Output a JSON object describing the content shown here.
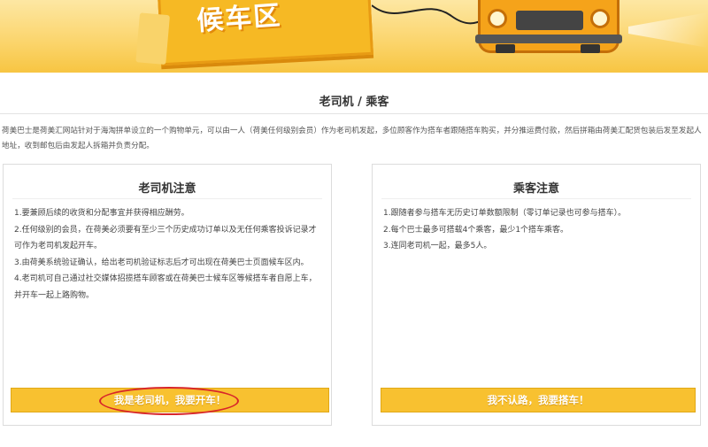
{
  "banner": {
    "title": "候车区"
  },
  "section": {
    "title": "老司机 / 乘客",
    "intro": "荷美巴士是荷美汇网站针对于海淘拼单设立的一个购物单元，可以由一人（荷美任何级别会员）作为老司机发起，多位顾客作为搭车者跟随搭车购买，并分推运费付款，然后拼箱由荷美汇配货包装后发至发起人地址，收到邮包后由发起人拆箱并负责分配。"
  },
  "driver_card": {
    "title": "老司机注意",
    "rules": [
      "1.要兼顾后续的收货和分配事宜并获得相应酬劳。",
      "2.任何级别的会员，在荷美必须要有至少三个历史成功订单以及无任何乘客投诉记录才可作为老司机发起开车。",
      "3.由荷美系统验证确认，给出老司机验证标志后才可出现在荷美巴士页面候车区内。",
      "4.老司机可自己通过社交媒体招揽搭车顾客或在荷美巴士候车区等候搭车者自愿上车，并开车一起上路购物。"
    ],
    "button_label": "我是老司机，我要开车！"
  },
  "passenger_card": {
    "title": "乘客注意",
    "rules": [
      "1.跟随者参与搭车无历史订单数额限制（零订单记录也可参与搭车）。",
      "2.每个巴士最多可搭载4个乘客，最少1个搭车乘客。",
      "3.连同老司机一起，最多5人。"
    ],
    "button_label": "我不认路，我要搭车！"
  },
  "colors": {
    "accent": "#f8c130",
    "highlight_ring": "#d8262a"
  }
}
